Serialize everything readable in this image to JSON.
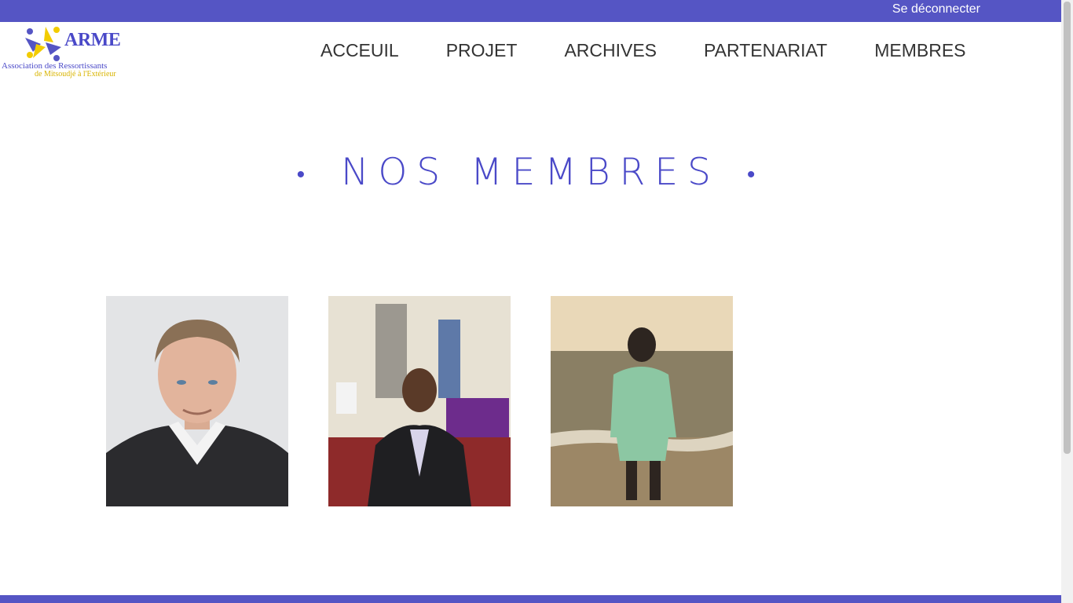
{
  "header": {
    "logout_label": "Se déconnecter"
  },
  "logo": {
    "name": "ARME",
    "line1": "Association des Ressortissants",
    "line2": "de Mitsoudjé à l'Extérieur"
  },
  "nav": {
    "items": [
      {
        "label": "ACCEUIL"
      },
      {
        "label": "PROJET"
      },
      {
        "label": "ARCHIVES"
      },
      {
        "label": "PARTENARIAT"
      },
      {
        "label": "MEMBRES"
      }
    ]
  },
  "main": {
    "title": "NOS MEMBRES",
    "dot": "•"
  },
  "members": [
    {
      "photo": "member-photo-1"
    },
    {
      "photo": "member-photo-2"
    },
    {
      "photo": "member-photo-3"
    }
  ],
  "colors": {
    "brand": "#5555c4",
    "title": "#4a49c8",
    "logo_yellow": "#f2cc00"
  }
}
